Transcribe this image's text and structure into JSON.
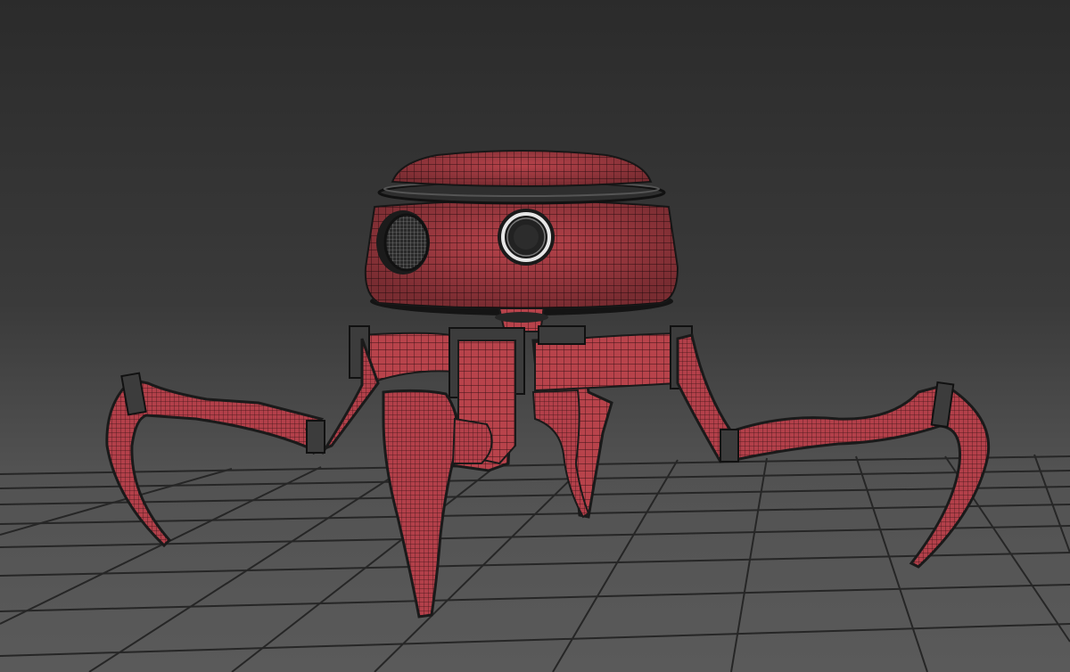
{
  "viewport": {
    "label": "",
    "model_name": "",
    "background_top": "#2b2b2b",
    "background_bottom": "#5a5a5a",
    "grid_color": "#262626",
    "mesh_fill": "#b8434b",
    "mesh_wire": "#3a1216",
    "metal_color": "#3c3c3c",
    "eye_ring_color": "#e6e6e6"
  }
}
